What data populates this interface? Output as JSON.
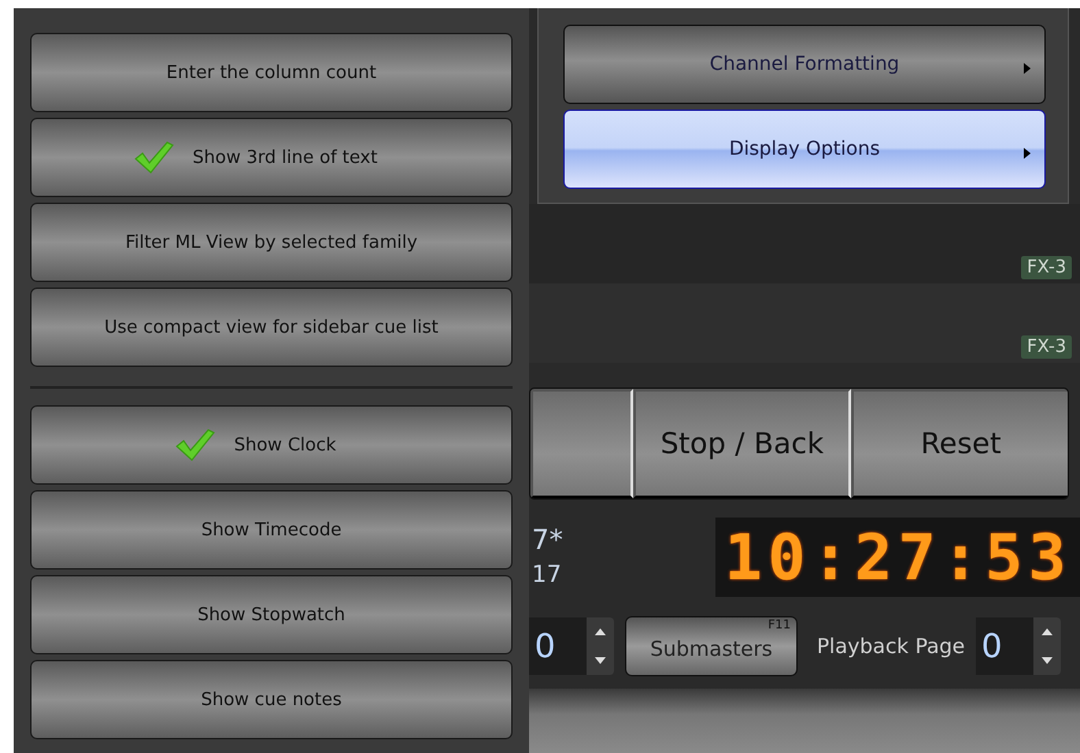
{
  "menu": {
    "groups": [
      {
        "items": [
          {
            "label": "Enter the column count",
            "checked": false
          },
          {
            "label": "Show 3rd line of text",
            "checked": true
          },
          {
            "label": "Filter ML View by selected family",
            "checked": false
          },
          {
            "label": "Use compact view for sidebar cue list",
            "checked": false
          }
        ]
      },
      {
        "items": [
          {
            "label": "Show Clock",
            "checked": true
          },
          {
            "label": "Show Timecode",
            "checked": false
          },
          {
            "label": "Show Stopwatch",
            "checked": false
          },
          {
            "label": "Show cue notes",
            "checked": false
          }
        ]
      }
    ]
  },
  "submenu_panel": {
    "items": [
      {
        "label": "Channel Formatting",
        "selected": false
      },
      {
        "label": "Display Options",
        "selected": true
      }
    ]
  },
  "cue_rows": [
    {
      "tag": "FX-3"
    },
    {
      "tag": "FX-3"
    }
  ],
  "playback_buttons": [
    "Stop / Back",
    "Reset"
  ],
  "cue_info": {
    "line_1": "7*",
    "line_2": "17"
  },
  "clock": {
    "time": "10:27:53"
  },
  "controls": {
    "left_spinner": {
      "value": "0"
    },
    "submasters": {
      "label": "Submasters",
      "shortcut": "F11"
    },
    "playback_page": {
      "label": "Playback Page",
      "value": "0"
    }
  }
}
